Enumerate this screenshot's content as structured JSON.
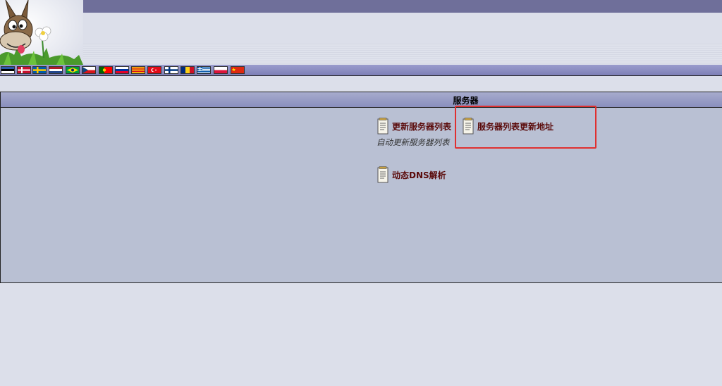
{
  "header": {
    "logo_name": "emule-donkey-logo",
    "flags": [
      "flag-estonia",
      "flag-denmark",
      "flag-sweden",
      "flag-netherlands",
      "flag-brazil",
      "flag-czech",
      "flag-portugal",
      "flag-slovenia",
      "flag-catalonia",
      "flag-turkey",
      "flag-finland",
      "flag-romania",
      "flag-greece",
      "flag-poland",
      "flag-china"
    ]
  },
  "panel": {
    "title": "服务器",
    "items": [
      {
        "label": "更新服务器列表",
        "description": "自动更新服务器列表"
      },
      {
        "label": "服务器列表更新地址"
      },
      {
        "label": "动态DNS解析"
      }
    ]
  },
  "colors": {
    "top_bar": "#6f6f9a",
    "panel_bg": "#b9c0d3",
    "link_text": "#5a0a0a",
    "highlight": "#e03030"
  }
}
